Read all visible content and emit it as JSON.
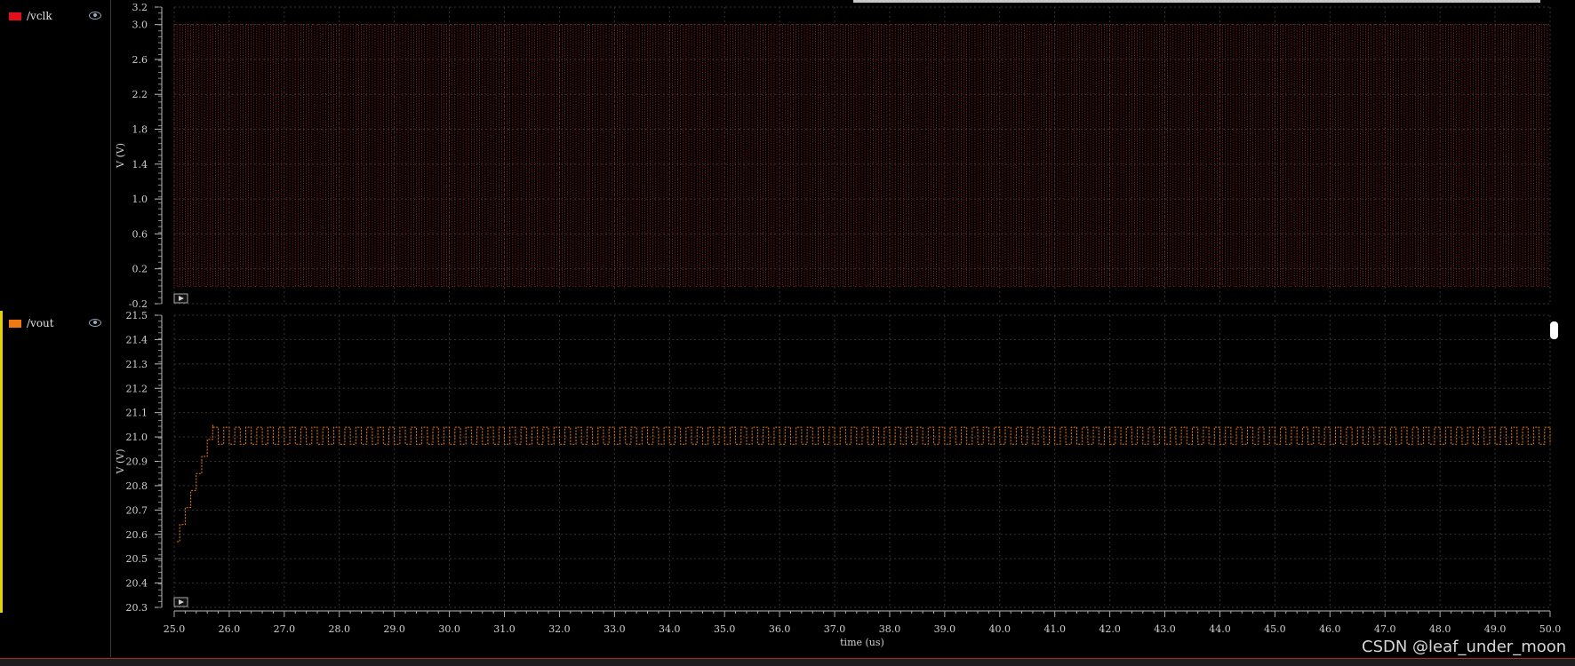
{
  "signals": [
    {
      "name": "/vclk",
      "color": "#e0101a"
    },
    {
      "name": "/vout",
      "color": "#f07a10"
    }
  ],
  "watermark": "CSDN @leaf_under_moon",
  "chart_data": [
    {
      "type": "line",
      "series": [
        {
          "name": "/vclk",
          "color": "#c0282d",
          "description_values": {
            "low": 0.0,
            "high": 3.0,
            "period_us": 0.1
          }
        }
      ],
      "x": {
        "label": "time (us)",
        "range": [
          25.0,
          50.0
        ]
      },
      "ylabel": "V (V)",
      "ylim": [
        -0.2,
        3.2
      ],
      "yticks": [
        "3.2",
        "3.0",
        "2.6",
        "2.2",
        "1.8",
        "1.4",
        "1.0",
        "0.6",
        "0.2",
        "-0.2"
      ],
      "ytick_values": [
        3.2,
        3.0,
        2.6,
        2.2,
        1.8,
        1.4,
        1.0,
        0.6,
        0.2,
        -0.2
      ],
      "grid": true
    },
    {
      "type": "line",
      "series": [
        {
          "name": "/vout",
          "color": "#f07a10",
          "ramp": [
            [
              25.05,
              20.57
            ],
            [
              25.1,
              20.64
            ],
            [
              25.2,
              20.71
            ],
            [
              25.3,
              20.78
            ],
            [
              25.4,
              20.85
            ],
            [
              25.5,
              20.92
            ],
            [
              25.6,
              20.99
            ],
            [
              25.7,
              21.05
            ]
          ],
          "steady": {
            "high": 21.04,
            "low": 20.97,
            "period_us": 0.2
          }
        }
      ],
      "x": {
        "label": "time (us)",
        "range": [
          25.0,
          50.0
        ],
        "ticks": [
          "25.0",
          "26.0",
          "27.0",
          "28.0",
          "29.0",
          "30.0",
          "31.0",
          "32.0",
          "33.0",
          "34.0",
          "35.0",
          "36.0",
          "37.0",
          "38.0",
          "39.0",
          "40.0",
          "41.0",
          "42.0",
          "43.0",
          "44.0",
          "45.0",
          "46.0",
          "47.0",
          "48.0",
          "49.0",
          "50.0"
        ]
      },
      "ylabel": "V (V)",
      "ylim": [
        20.3,
        21.5
      ],
      "yticks": [
        "21.5",
        "21.4",
        "21.3",
        "21.2",
        "21.1",
        "21.0",
        "20.9",
        "20.8",
        "20.7",
        "20.6",
        "20.5",
        "20.4",
        "20.3"
      ],
      "ytick_values": [
        21.5,
        21.4,
        21.3,
        21.2,
        21.1,
        21.0,
        20.9,
        20.8,
        20.7,
        20.6,
        20.5,
        20.4,
        20.3
      ],
      "grid": true
    }
  ]
}
